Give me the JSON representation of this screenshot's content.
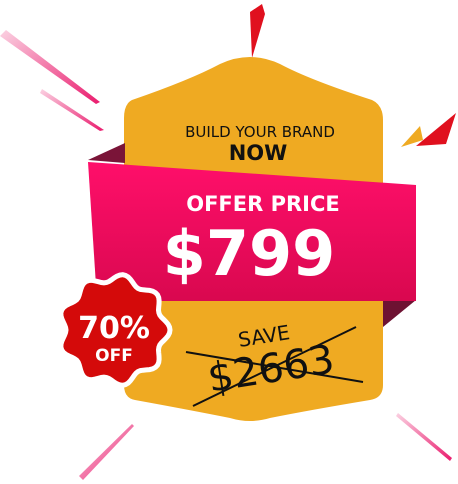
{
  "badge": {
    "headline": "BUILD YOUR BRAND",
    "headline_emphasis": "NOW",
    "offer_label": "OFFER PRICE",
    "offer_price": "$799",
    "save_label": "SAVE",
    "original_price": "$2663",
    "discount_percent": "70%",
    "discount_suffix": "OFF"
  },
  "colors": {
    "badge_yellow": "#EFAA22",
    "ribbon_pink": "#F20D63",
    "ribbon_fold": "#7A1438",
    "discount_red": "#D40A0A",
    "spike_red": "#E0101E",
    "spike_pink": "#EA1C6E"
  }
}
